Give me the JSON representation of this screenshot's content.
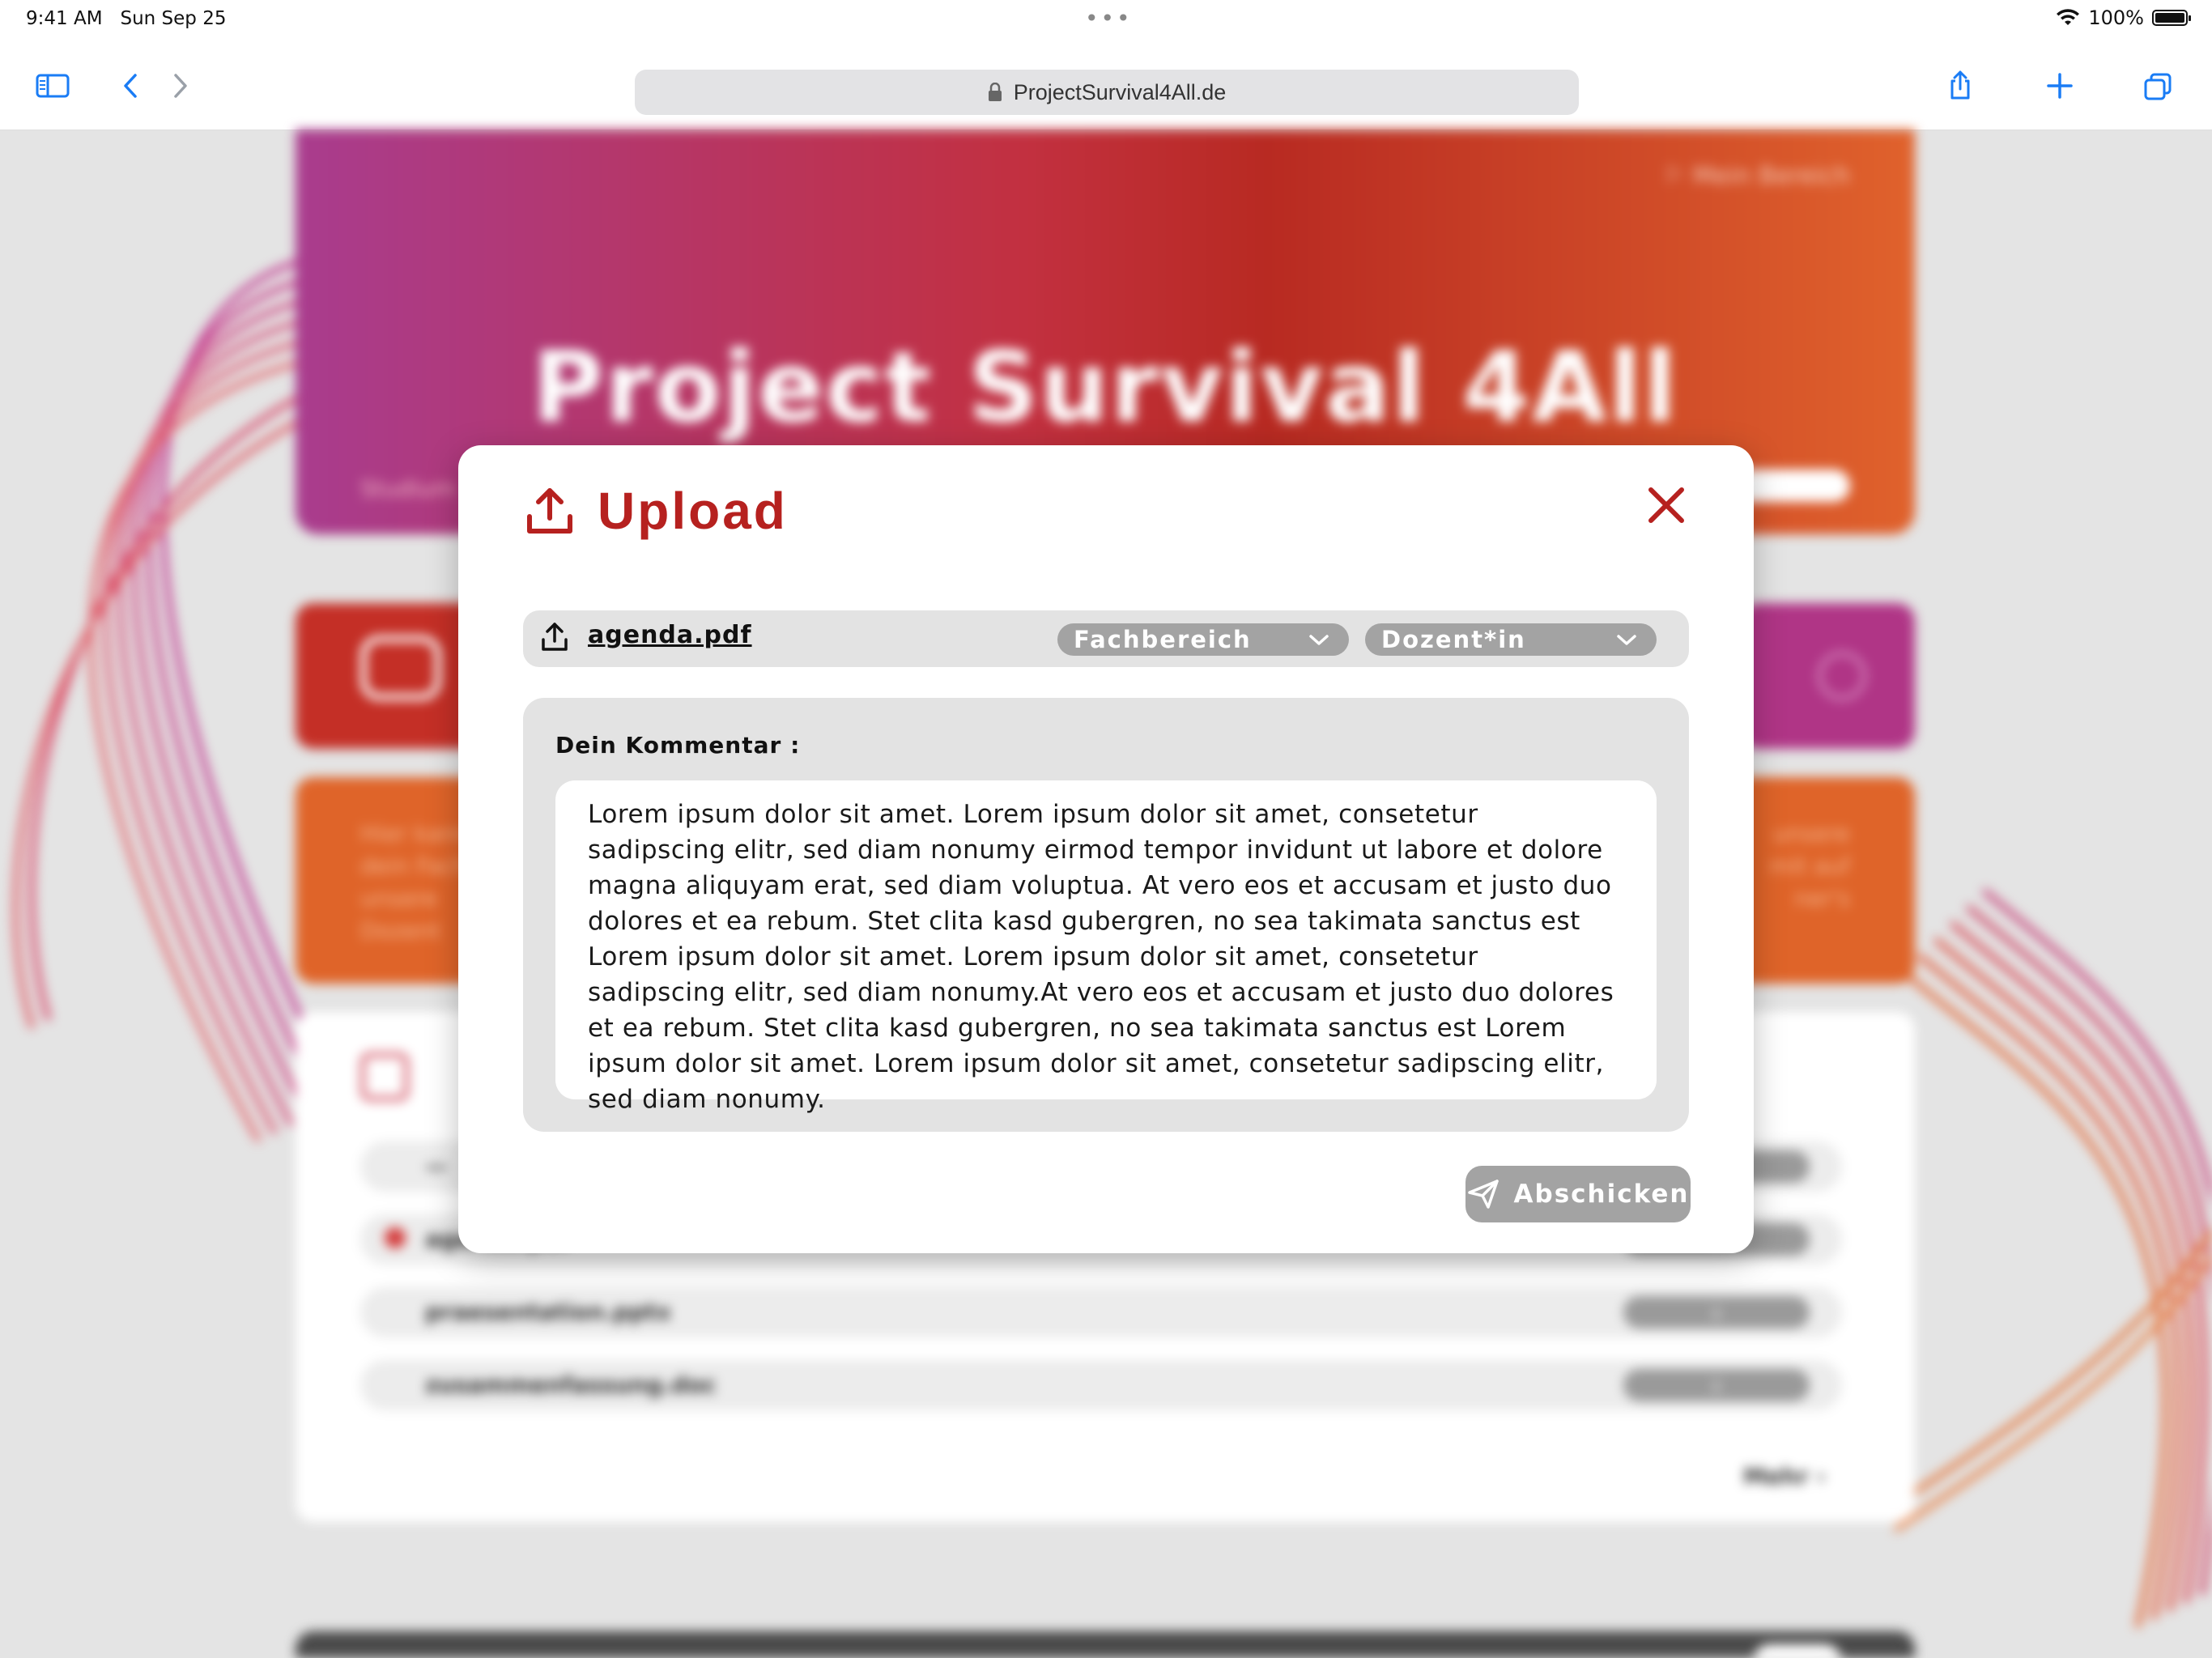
{
  "status_bar": {
    "time": "9:41 AM",
    "date": "Sun Sep 25",
    "battery": "100%"
  },
  "browser": {
    "url": "ProjectSurvival4All.de"
  },
  "background": {
    "hero_title": "Project Survival 4All",
    "files": [
      "agenda.pdf",
      "praesentation.pptx",
      "zusammenfassung.doc"
    ]
  },
  "modal": {
    "title": "Upload",
    "file_name": "agenda.pdf",
    "select_faculty": "Fachbereich",
    "select_lecturer": "Dozent*in",
    "comment_label": "Dein Kommentar :",
    "comment_text": "Lorem ipsum dolor sit amet. Lorem ipsum dolor sit amet, consetetur sadipscing elitr, sed diam nonumy eirmod tempor invidunt ut labore et dolore magna aliquyam erat, sed diam voluptua. At vero eos et accusam et justo duo dolores et ea rebum. Stet clita kasd gubergren, no sea takimata sanctus est Lorem ipsum dolor sit amet. Lorem ipsum dolor sit amet, consetetur sadipscing elitr, sed diam nonumy.At vero eos et accusam et justo duo dolores et ea rebum. Stet clita kasd gubergren, no sea takimata sanctus est Lorem ipsum dolor sit amet. Lorem ipsum dolor sit amet, consetetur sadipscing elitr, sed diam nonumy.",
    "send_label": "Abschicken"
  },
  "colors": {
    "accent": "#b6211f",
    "button_gray": "#a3a3a3",
    "panel_gray": "#e3e3e3"
  }
}
